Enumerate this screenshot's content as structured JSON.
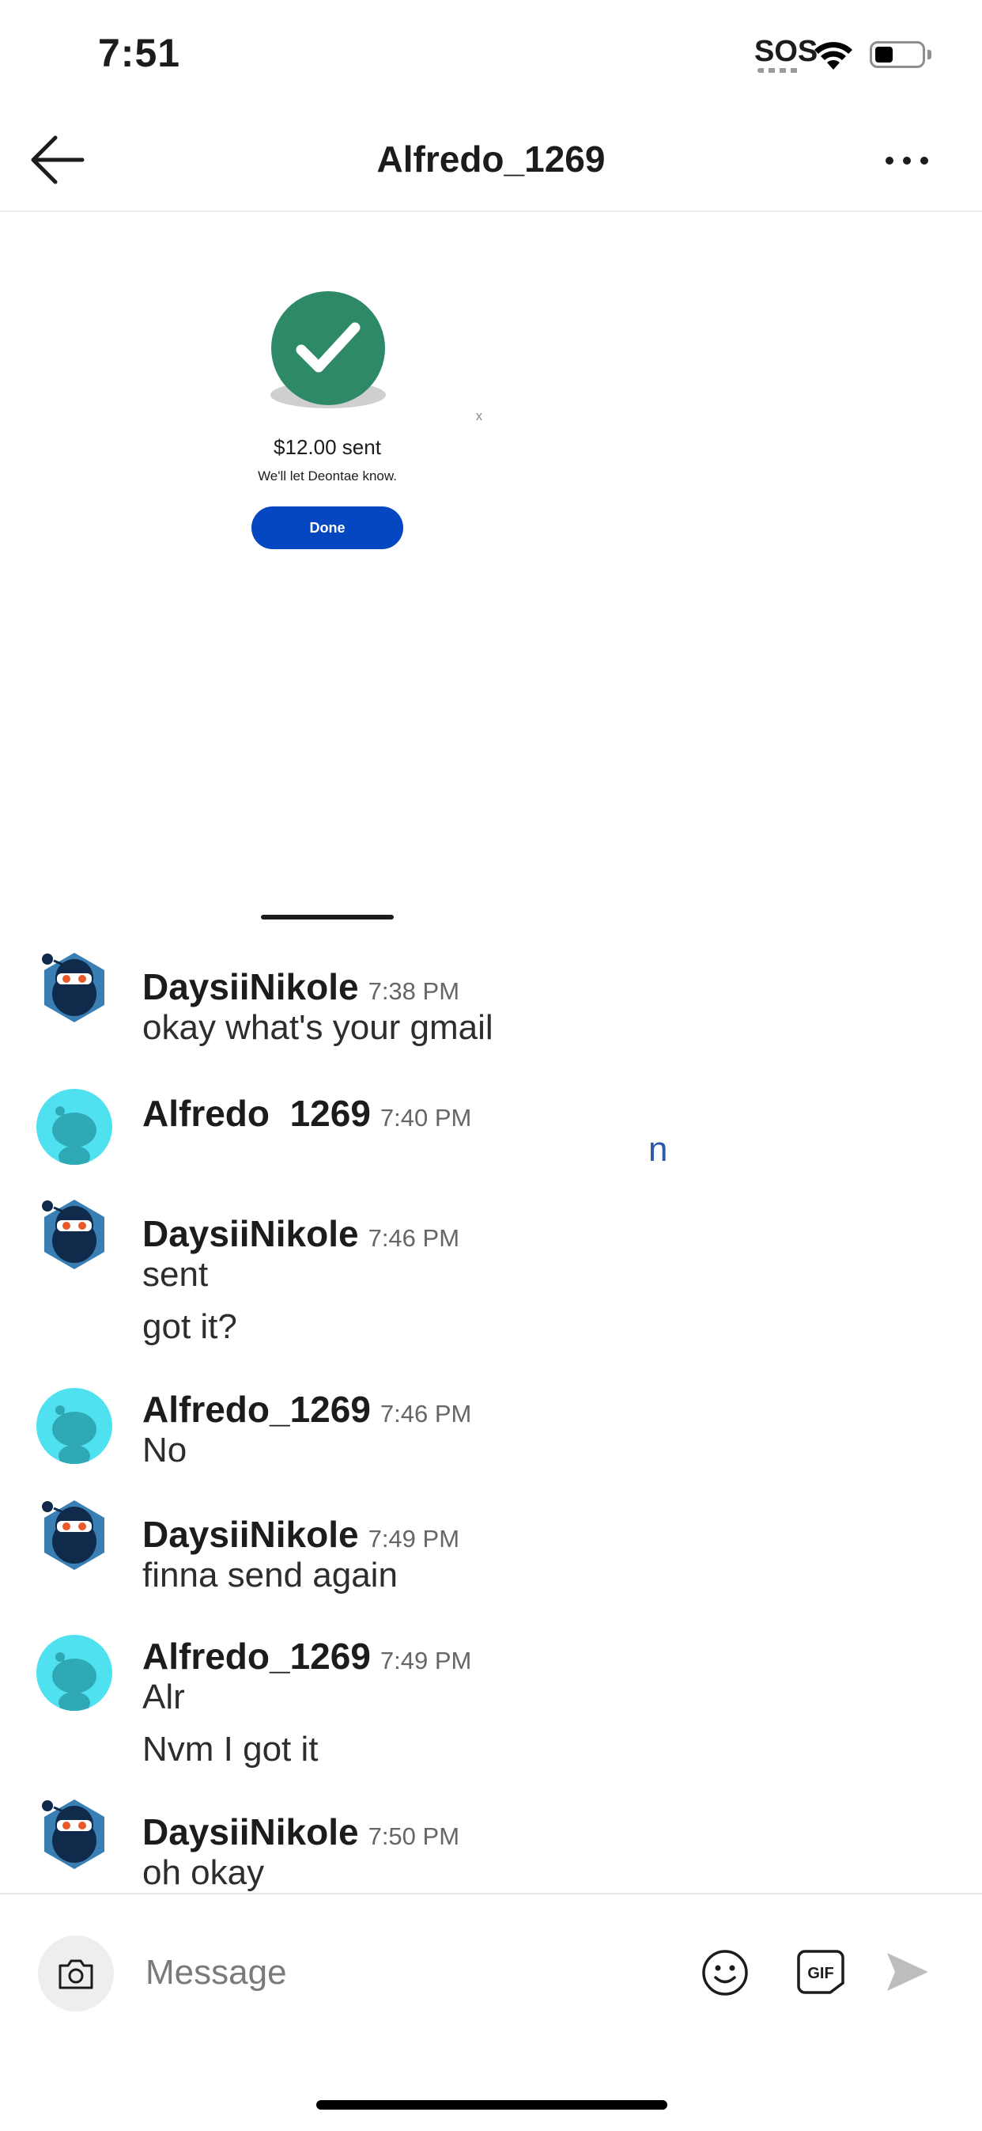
{
  "status_bar": {
    "time": "7:51",
    "sos": "SOS"
  },
  "header": {
    "title": "Alfredo_1269"
  },
  "payment": {
    "amount": "$12.00 sent",
    "note": "We'll let Deontae know.",
    "button": "Done"
  },
  "messages": [
    {
      "sender": "DaysiiNikole",
      "time": "7:38 PM",
      "lines": [
        "okay what's your gmail"
      ],
      "avatar": "ninja-snoo-icon"
    },
    {
      "sender": "Alfredo_1269",
      "time": "7:40 PM",
      "lines": [
        "n"
      ],
      "avatar": "snoo-icon"
    },
    {
      "sender": "DaysiiNikole",
      "time": "7:46 PM",
      "lines": [
        "sent",
        "got it?"
      ],
      "avatar": "ninja-snoo-icon"
    },
    {
      "sender": "Alfredo_1269",
      "time": "7:46 PM",
      "lines": [
        "No"
      ],
      "avatar": "snoo-icon"
    },
    {
      "sender": "DaysiiNikole",
      "time": "7:49 PM",
      "lines": [
        "finna send again"
      ],
      "avatar": "ninja-snoo-icon"
    },
    {
      "sender": "Alfredo_1269",
      "time": "7:49 PM",
      "lines": [
        "Alr",
        "Nvm I got it"
      ],
      "avatar": "snoo-icon"
    },
    {
      "sender": "DaysiiNikole",
      "time": "7:50 PM",
      "lines": [
        "oh okay"
      ],
      "avatar": "ninja-snoo-icon"
    }
  ],
  "composer": {
    "placeholder": "Message",
    "gif_label": "GIF"
  },
  "colors": {
    "accent": "#0547c1",
    "success": "#2e8a66",
    "snoo_bg": "#4fe1ef"
  }
}
